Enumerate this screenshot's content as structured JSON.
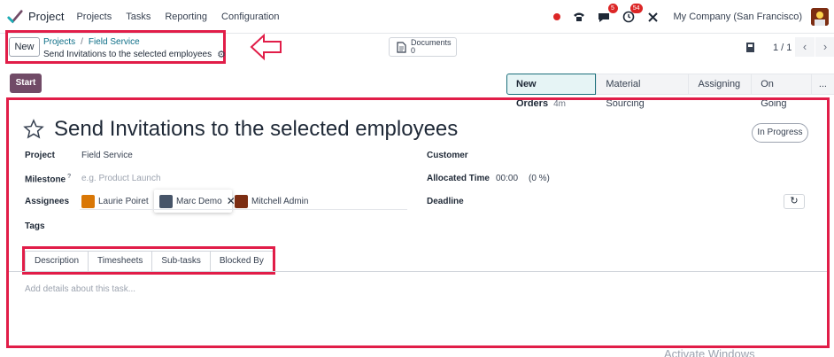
{
  "nav": {
    "app_name": "Project",
    "menu": [
      "Projects",
      "Tasks",
      "Reporting",
      "Configuration"
    ],
    "chat_badge": "5",
    "activity_badge": "54",
    "company": "My Company (San Francisco)"
  },
  "control": {
    "new_label": "New",
    "breadcrumb": [
      "Projects",
      "Field Service"
    ],
    "record_title": "Send Invitations to the selected employees",
    "documents_label": "Documents",
    "documents_count": "0",
    "pager": "1 / 1"
  },
  "status": {
    "start_label": "Start",
    "stages": [
      {
        "label": "New Orders",
        "time": "4m",
        "active": true
      },
      {
        "label": "Material Sourcing"
      },
      {
        "label": "Assigning"
      },
      {
        "label": "On Going"
      },
      {
        "label": "..."
      }
    ]
  },
  "task": {
    "title": "Send Invitations to the selected employees",
    "state": "In Progress",
    "project_label": "Project",
    "project_value": "Field Service",
    "milestone_label": "Milestone",
    "milestone_help": "?",
    "milestone_placeholder": "e.g. Product Launch",
    "assignees_label": "Assignees",
    "assignees": [
      "Laurie Poiret",
      "Marc Demo",
      "Mitchell Admin"
    ],
    "tags_label": "Tags",
    "customer_label": "Customer",
    "allocated_label": "Allocated Time",
    "allocated_value": "00:00",
    "allocated_pct": "(0 %)",
    "deadline_label": "Deadline"
  },
  "tabs": [
    "Description",
    "Timesheets",
    "Sub-tasks",
    "Blocked By"
  ],
  "description_placeholder": "Add details about this task...",
  "watermark": "Activate Windows",
  "colors": {
    "accent": "#714b67",
    "annotation": "#e11d48",
    "link": "#0d6e87"
  }
}
